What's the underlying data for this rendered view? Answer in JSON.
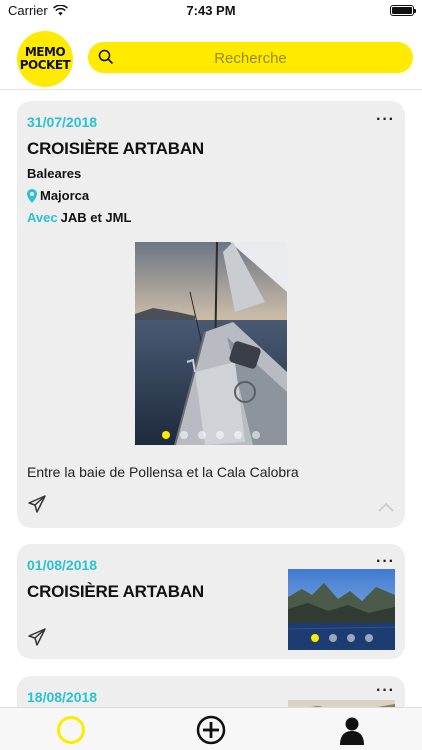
{
  "status_bar": {
    "carrier": "Carrier",
    "time": "7:43 PM"
  },
  "header": {
    "logo_line1": "MEMO",
    "logo_line2": "POCKET",
    "search_placeholder": "Recherche"
  },
  "colors": {
    "accent_yellow": "#ffea00",
    "accent_cyan": "#29c3d4",
    "card_bg": "#eeeeee"
  },
  "memories": [
    {
      "date": "31/07/2018",
      "title": "CROISIÈRE ARTABAN",
      "region": "Baleares",
      "location": "Majorca",
      "with_label": "Avec",
      "with_people": "JAB et JML",
      "caption": "Entre la baie de Pollensa et la Cala Calobra",
      "photo_count": 6,
      "active_photo": 1,
      "more_label": "···"
    },
    {
      "date": "01/08/2018",
      "title": "CROISIÈRE ARTABAN",
      "photo_count": 4,
      "active_photo": 1,
      "more_label": "···"
    },
    {
      "date": "18/08/2018",
      "more_label": "···"
    }
  ],
  "tabbar": {
    "icons": [
      "home-circle-icon",
      "add-circle-icon",
      "profile-icon"
    ]
  }
}
